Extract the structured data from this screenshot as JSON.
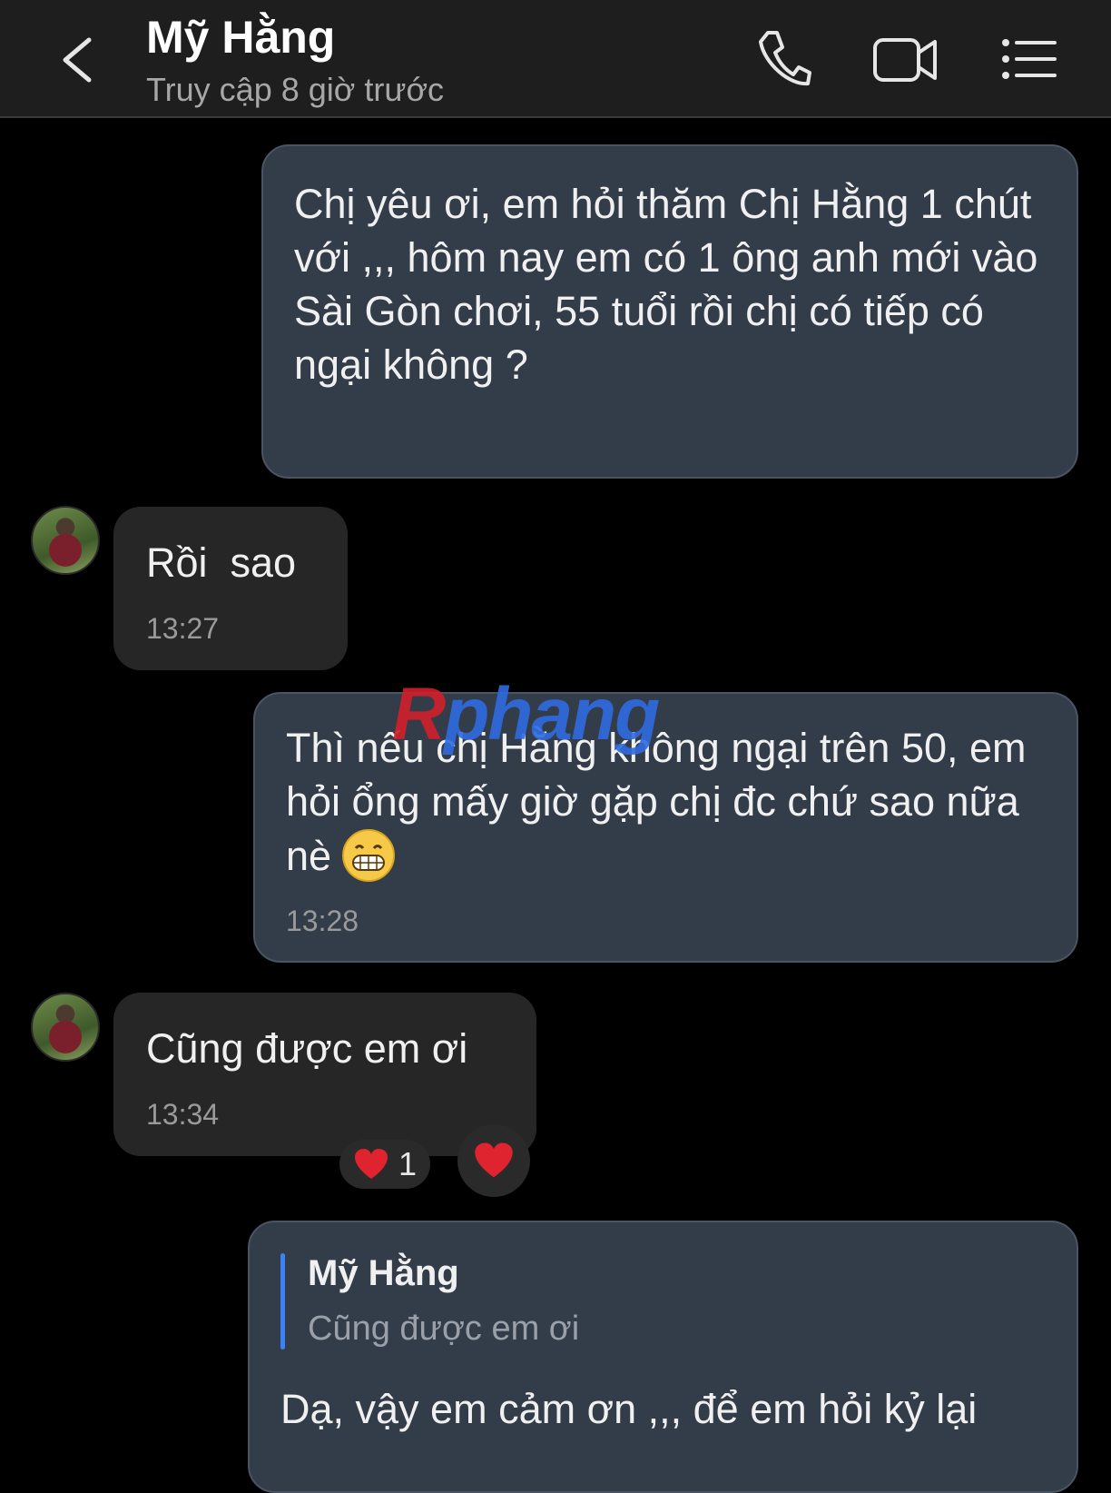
{
  "header": {
    "title": "Mỹ Hằng",
    "subtitle": "Truy cập 8 giờ trước"
  },
  "messages": [
    {
      "text": "Chị yêu ơi, em hỏi thăm Chị Hằng 1 chút với ,,, hôm nay em có 1 ông anh mới vào Sài Gòn chơi, 55 tuổi rồi chị có tiếp có ngại không ?"
    },
    {
      "text": "Rồi  sao",
      "time": "13:27"
    },
    {
      "text": "Thì nếu chị Hằng không ngại trên 50, em hỏi ổng mấy giờ gặp chị đc chứ sao nữa nè",
      "time": "13:28"
    },
    {
      "text": "Cũng được em ơi",
      "time": "13:34",
      "reaction_count": "1"
    },
    {
      "reply_to_name": "Mỹ Hằng",
      "reply_to_text": "Cũng được em ơi",
      "text": "Dạ, vậy em cảm ơn ,,, để em hỏi kỷ lại"
    }
  ],
  "watermark": {
    "first": "R",
    "rest": "phang"
  },
  "icons": [
    "back-icon",
    "phone-icon",
    "video-icon",
    "menu-icon",
    "heart-icon",
    "grin-emoji-icon"
  ]
}
